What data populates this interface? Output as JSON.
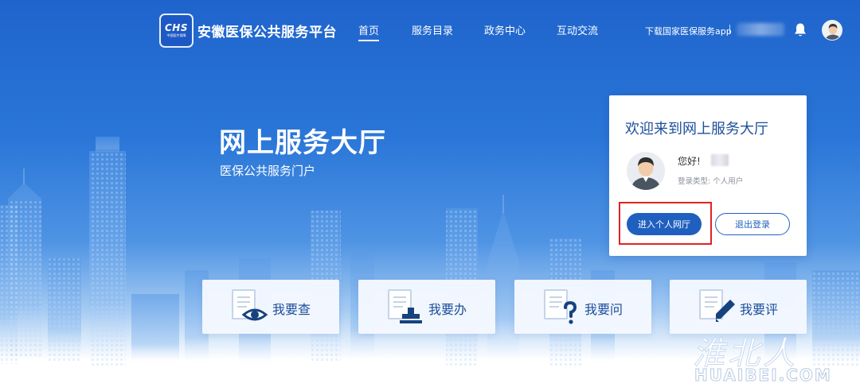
{
  "header": {
    "logo_text": "CHS",
    "logo_subtext": "中国医疗保障",
    "site_title": "安徽医保公共服务平台",
    "nav": [
      {
        "label": "首页",
        "active": true
      },
      {
        "label": "服务目录",
        "active": false
      },
      {
        "label": "政务中心",
        "active": false
      },
      {
        "label": "互动交流",
        "active": false
      }
    ],
    "download_link": "下载国家医保服务app",
    "icons": {
      "bell": "bell-icon",
      "avatar": "user-avatar-icon"
    }
  },
  "hero": {
    "title": "网上服务大厅",
    "subtitle": "医保公共服务门户"
  },
  "welcome_card": {
    "title": "欢迎来到网上服务大厅",
    "greeting": "您好!",
    "login_type": "登录类型: 个人用户",
    "enter_button": "进入个人网厅",
    "logout_button": "退出登录",
    "accent_color": "#1f5fbf",
    "highlight_color": "#e02323"
  },
  "services": [
    {
      "label": "我要查",
      "icon": "document-eye-icon"
    },
    {
      "label": "我要办",
      "icon": "document-stamp-icon"
    },
    {
      "label": "我要问",
      "icon": "document-question-icon"
    },
    {
      "label": "我要评",
      "icon": "document-pen-icon"
    }
  ],
  "watermark": {
    "text_cn": "淮北人",
    "text_en": "HUAIBEI.COM"
  }
}
